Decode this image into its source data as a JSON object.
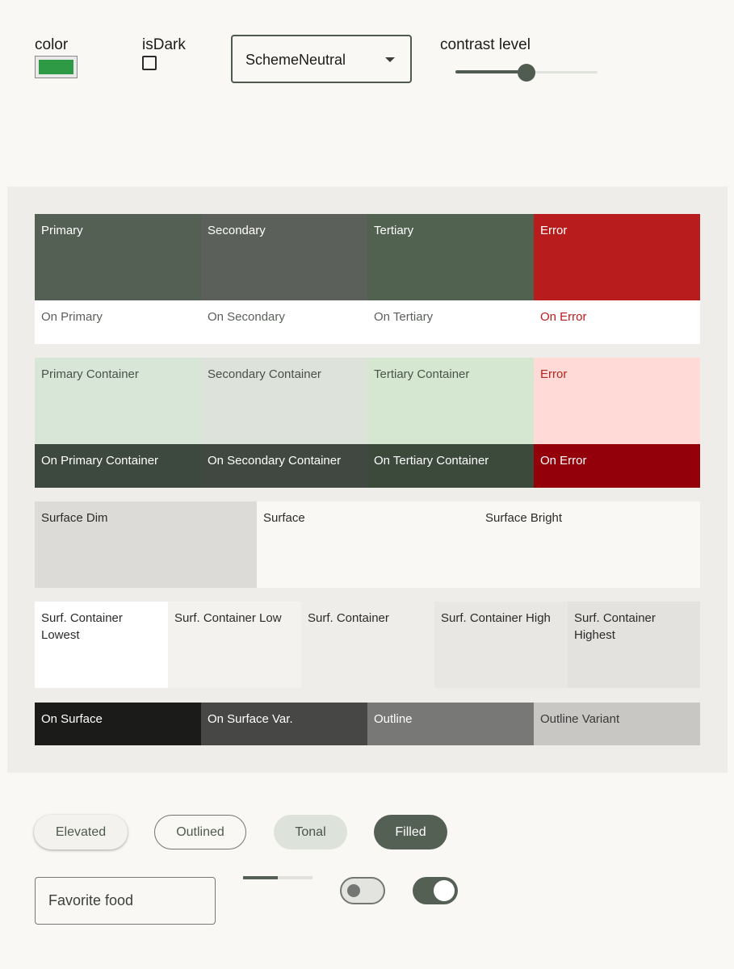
{
  "controls": {
    "color_label": "color",
    "color_value": "#2f9a45",
    "isdark_label": "isDark",
    "isdark_checked": false,
    "scheme_selected": "SchemeNeutral",
    "contrast_label": "contrast level",
    "contrast_fraction": 0.5
  },
  "palette": {
    "row1": [
      "Primary",
      "Secondary",
      "Tertiary",
      "Error"
    ],
    "row2": [
      "On Primary",
      "On Secondary",
      "On Tertiary",
      "On Error"
    ],
    "row3": [
      "Primary Container",
      "Secondary Container",
      "Tertiary Container",
      "Error"
    ],
    "row4": [
      "On Primary Container",
      "On Secondary Container",
      "On Tertiary Container",
      "On Error"
    ],
    "row5": [
      "Surface Dim",
      "Surface",
      "Surface Bright"
    ],
    "row6": [
      "Surf. Container Lowest",
      "Surf. Container Low",
      "Surf. Container",
      "Surf. Container High",
      "Surf. Container Highest"
    ],
    "row7": [
      "On Surface",
      "On Surface Var.",
      "Outline",
      "Outline Variant"
    ]
  },
  "components": {
    "buttons": [
      "Elevated",
      "Outlined",
      "Tonal",
      "Filled"
    ],
    "textfield_placeholder": "Favorite food",
    "progress_fraction": 0.5,
    "switch_off": false,
    "switch_on": true
  }
}
